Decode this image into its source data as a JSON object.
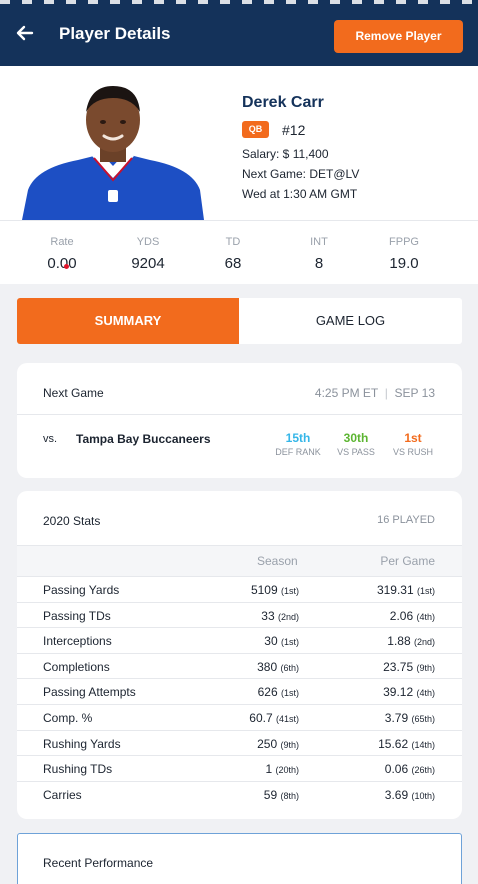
{
  "header": {
    "title": "Player Details",
    "remove_label": "Remove Player",
    "colors": {
      "bg": "#14325a",
      "accent": "#f26b1d"
    }
  },
  "player": {
    "name": "Derek Carr",
    "position": "QB",
    "jersey": "#12",
    "salary": "Salary: $ 11,400",
    "next_game": "Next Game: DET@LV",
    "game_time": "Wed at 1:30 AM GMT",
    "photo": "player-photo"
  },
  "summary_stats": [
    {
      "label": "Rate",
      "value": "0.00"
    },
    {
      "label": "YDS",
      "value": "9204"
    },
    {
      "label": "TD",
      "value": "68"
    },
    {
      "label": "INT",
      "value": "8"
    },
    {
      "label": "FPPG",
      "value": "19.0"
    }
  ],
  "tabs": [
    {
      "label": "SUMMARY",
      "active": true
    },
    {
      "label": "GAME LOG",
      "active": false
    }
  ],
  "next_game_card": {
    "label": "Next Game",
    "time": "4:25 PM ET",
    "date": "SEP 13",
    "vs": "vs.",
    "opponent": "Tampa Bay Buccaneers",
    "ranks": [
      {
        "value": "15th",
        "label": "DEF RANK",
        "color": "#35b6e8"
      },
      {
        "value": "30th",
        "label": "VS PASS",
        "color": "#5cb531"
      },
      {
        "value": "1st",
        "label": "VS RUSH",
        "color": "#f26b1d"
      }
    ]
  },
  "stats_card": {
    "title": "2020 Stats",
    "played": "16 PLAYED",
    "col_season": "Season",
    "col_per_game": "Per Game",
    "rows": [
      {
        "name": "Passing Yards",
        "season": "5109",
        "season_rank": "(1st)",
        "per_game": "319.31",
        "per_game_rank": "(1st)"
      },
      {
        "name": "Passing TDs",
        "season": "33",
        "season_rank": "(2nd)",
        "per_game": "2.06",
        "per_game_rank": "(4th)"
      },
      {
        "name": "Interceptions",
        "season": "30",
        "season_rank": "(1st)",
        "per_game": "1.88",
        "per_game_rank": "(2nd)"
      },
      {
        "name": "Completions",
        "season": "380",
        "season_rank": "(6th)",
        "per_game": "23.75",
        "per_game_rank": "(9th)"
      },
      {
        "name": "Passing Attempts",
        "season": "626",
        "season_rank": "(1st)",
        "per_game": "39.12",
        "per_game_rank": "(4th)"
      },
      {
        "name": "Comp. %",
        "season": "60.7",
        "season_rank": "(41st)",
        "per_game": "3.79",
        "per_game_rank": "(65th)"
      },
      {
        "name": "Rushing Yards",
        "season": "250",
        "season_rank": "(9th)",
        "per_game": "15.62",
        "per_game_rank": "(14th)"
      },
      {
        "name": "Rushing TDs",
        "season": "1",
        "season_rank": "(20th)",
        "per_game": "0.06",
        "per_game_rank": "(26th)"
      },
      {
        "name": "Carries",
        "season": "59",
        "season_rank": "(8th)",
        "per_game": "3.69",
        "per_game_rank": "(10th)"
      }
    ]
  },
  "recent_card": {
    "title": "Recent Performance"
  }
}
